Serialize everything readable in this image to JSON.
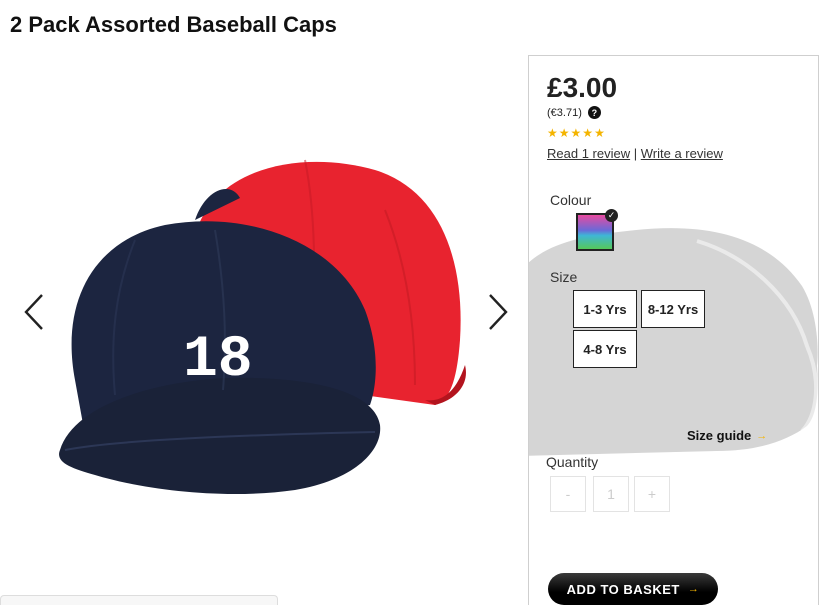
{
  "product": {
    "title": "2 Pack Assorted Baseball Caps",
    "price": "£3.00",
    "alt_price": "(€3.71)",
    "rating_stars": 5,
    "review_link": "Read 1 review",
    "separator": "|",
    "write_review": "Write a review",
    "cap_number": "18"
  },
  "options": {
    "colour_label": "Colour",
    "size_label": "Size",
    "sizes": [
      "1-3 Yrs",
      "8-12 Yrs",
      "4-8 Yrs"
    ],
    "size_guide": "Size guide"
  },
  "quantity": {
    "label": "Quantity",
    "minus": "-",
    "value": "1",
    "plus": "+"
  },
  "actions": {
    "add_to_basket": "ADD TO BASKET"
  },
  "icons": {
    "help": "?",
    "star": "★",
    "chevron_right": "→",
    "check": "✓"
  },
  "colors": {
    "navy_cap": "#1c2540",
    "red_cap": "#e8232f",
    "star": "#f4b400",
    "button": "#000000"
  }
}
